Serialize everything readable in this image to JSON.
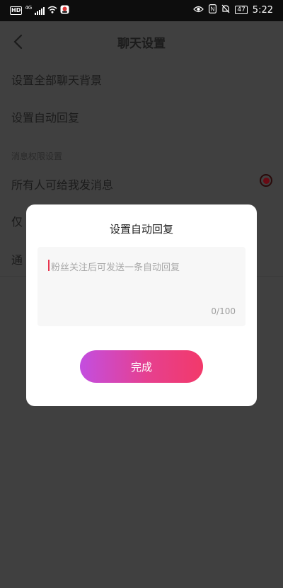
{
  "status_bar": {
    "hd": "HD",
    "network": "4G",
    "battery": "47",
    "time": "5:22",
    "icons": [
      "hd-icon",
      "signal-icon",
      "wifi-icon",
      "app-notification-icon",
      "eye-icon",
      "nfc-icon",
      "mute-icon",
      "battery-icon"
    ]
  },
  "header": {
    "title": "聊天设置",
    "back_icon": "chevron-left-icon"
  },
  "settings": {
    "set_all_background": "设置全部聊天背景",
    "set_auto_reply": "设置自动回复",
    "section_label": "消息权限设置",
    "everyone_can_message": "所有人可给我发消息",
    "only_partial": "仅",
    "notify_partial": "通"
  },
  "dialog": {
    "title": "设置自动回复",
    "placeholder": "粉丝关注后可发送一条自动回复",
    "counter": "0/100",
    "done_label": "完成"
  },
  "colors": {
    "overlay_bg": "#404040",
    "button_gradient_start": "#c34ee0",
    "button_gradient_end": "#f2396a",
    "radio_selected": "#6a0a14",
    "caret": "#e8364f"
  }
}
